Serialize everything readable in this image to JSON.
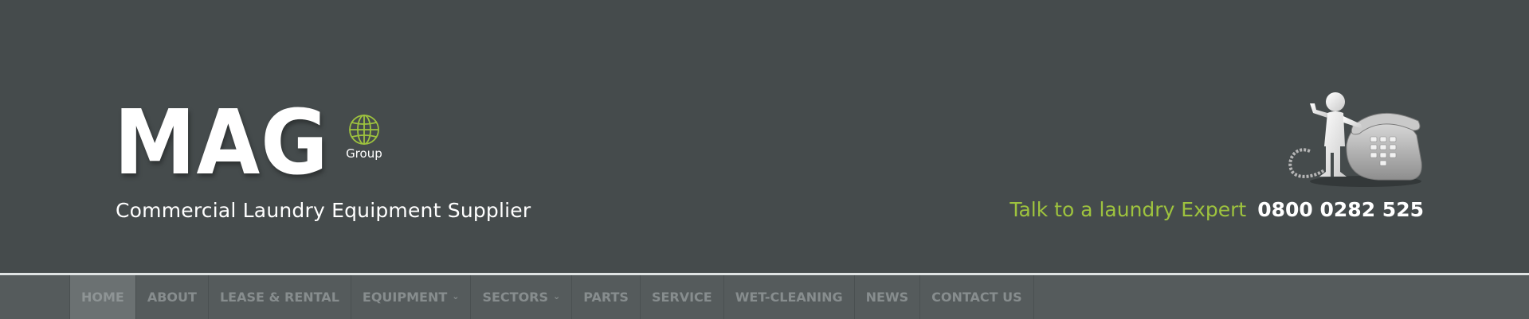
{
  "brand": {
    "name": "MAG",
    "badge": "Group",
    "tagline": "Commercial Laundry Equipment Supplier",
    "accent_color": "#9ec33e"
  },
  "contact": {
    "label": "Talk to a laundry Expert",
    "phone": "0800 0282 525"
  },
  "nav": {
    "items": [
      {
        "label": "HOME",
        "active": true
      },
      {
        "label": "ABOUT"
      },
      {
        "label": "LEASE & RENTAL"
      },
      {
        "label": "EQUIPMENT",
        "has_dropdown": true
      },
      {
        "label": "SECTORS",
        "has_dropdown": true
      },
      {
        "label": "PARTS"
      },
      {
        "label": "SERVICE"
      },
      {
        "label": "WET-CLEANING"
      },
      {
        "label": "NEWS"
      },
      {
        "label": "CONTACT US"
      }
    ]
  },
  "icons": {
    "globe": "globe-icon",
    "phone_figure": "phone-figure-illustration",
    "caret": "chevron-down-icon"
  }
}
